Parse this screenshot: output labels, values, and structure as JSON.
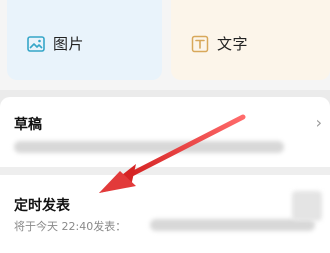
{
  "cards": {
    "image": {
      "label": "图片",
      "icon": "image-icon"
    },
    "text": {
      "label": "文字",
      "icon": "text-icon"
    }
  },
  "rows": {
    "drafts": {
      "title": "草稿"
    },
    "scheduled": {
      "title": "定时发表",
      "subtitle": "将于今天 22:40发表："
    }
  },
  "colors": {
    "image_card_bg": "#e9f3fb",
    "text_card_bg": "#fcf5ea",
    "image_icon": "#36a6c8",
    "text_icon": "#d8a85a",
    "arrow": "#e23a3a"
  }
}
